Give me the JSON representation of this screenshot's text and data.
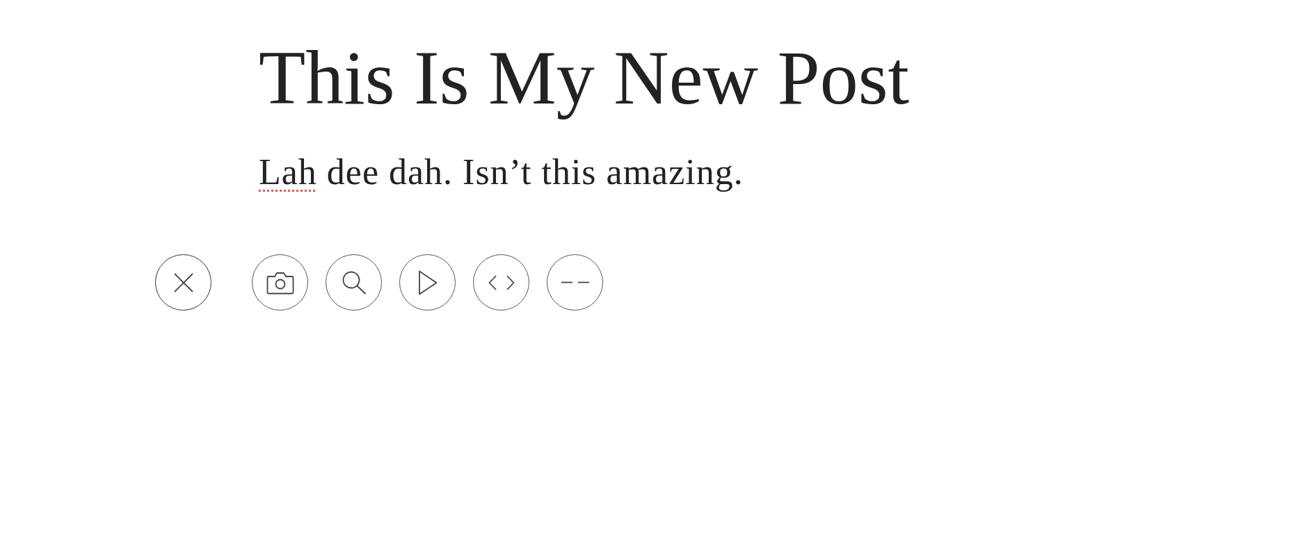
{
  "post": {
    "title": "This Is My New Post",
    "body": [
      {
        "text": "Lah",
        "misspelled": true
      },
      {
        "text": "dee dah. Isn’t this amazing.",
        "misspelled": false
      }
    ]
  },
  "toolbar": {
    "buttons": [
      {
        "kind": "close"
      },
      {
        "kind": "image"
      },
      {
        "kind": "search"
      },
      {
        "kind": "video"
      },
      {
        "kind": "embed"
      },
      {
        "kind": "divider"
      }
    ]
  }
}
